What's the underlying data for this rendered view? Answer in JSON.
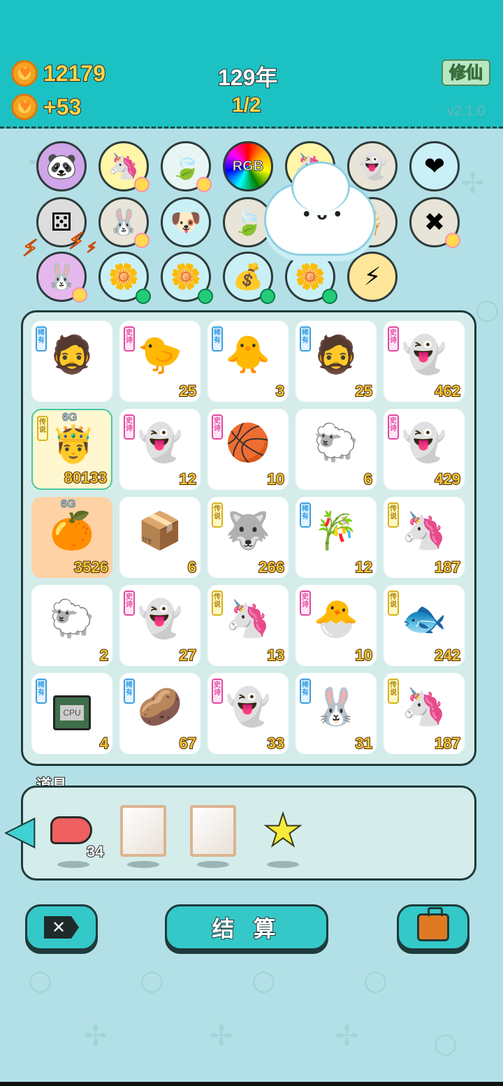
{
  "header": {
    "coins": "12179",
    "coin_gain": "+53",
    "year": "129年",
    "round": "1/2",
    "cultivate_label": "修仙",
    "version": "v2.1.0"
  },
  "relics": {
    "row1": [
      "panda-icon",
      "unicorn-icon",
      "leaf-icon",
      "rgb-orb-icon",
      "unicorn-icon",
      "ghost-wink-icon",
      "heart-potion-icon"
    ],
    "row2": [
      "dice-icon",
      "rabbit-icon",
      "cool-dog-icon",
      "leaf-icon",
      "",
      "ice-cream-icon",
      "delete-tag-icon"
    ],
    "row3": [
      "rabbit-icon",
      "flower-pot-icon",
      "flower-pot-icon",
      "sack-icon",
      "flower-pot-icon",
      "lightning-orb-icon"
    ],
    "rgb_label": "RGB"
  },
  "board": {
    "rows": [
      [
        {
          "name": "hat-man",
          "icon": "hat-man-icon",
          "rarity": "稀有",
          "count": ""
        },
        {
          "name": "chick-face",
          "icon": "chick-face-icon",
          "rarity": "史诗",
          "count": "25"
        },
        {
          "name": "chicken",
          "icon": "chicken-icon",
          "rarity": "稀有",
          "count": "3"
        },
        {
          "name": "hat-man",
          "icon": "hat-man-icon",
          "rarity": "稀有",
          "count": "25"
        },
        {
          "name": "ghost",
          "icon": "ghost-icon",
          "rarity": "史诗",
          "count": "462"
        }
      ],
      [
        {
          "name": "king-man",
          "icon": "king-man-icon",
          "rarity": "传说",
          "count": "80133",
          "tag": "6G"
        },
        {
          "name": "ghost",
          "icon": "ghost-icon",
          "rarity": "史诗",
          "count": "12"
        },
        {
          "name": "basketball-chick",
          "icon": "basketball-chick-icon",
          "rarity": "史诗",
          "count": "10"
        },
        {
          "name": "sheep",
          "icon": "sheep-icon",
          "rarity": "",
          "count": "6"
        },
        {
          "name": "ghost",
          "icon": "ghost-icon",
          "rarity": "史诗",
          "count": "429"
        }
      ],
      [
        {
          "name": "fruit",
          "icon": "fruit-icon",
          "rarity": "",
          "count": "3526",
          "tag": "6G"
        },
        {
          "name": "package",
          "icon": "package-icon",
          "rarity": "",
          "count": "6"
        },
        {
          "name": "husky-king",
          "icon": "husky-icon",
          "rarity": "传说",
          "count": "266"
        },
        {
          "name": "bamboo",
          "icon": "bamboo-icon",
          "rarity": "稀有",
          "count": "12"
        },
        {
          "name": "unicorn",
          "icon": "unicorn-icon",
          "rarity": "传说",
          "count": "187"
        }
      ],
      [
        {
          "name": "sheep",
          "icon": "sheep-icon",
          "rarity": "",
          "count": "2"
        },
        {
          "name": "ghost",
          "icon": "ghost-icon",
          "rarity": "史诗",
          "count": "27"
        },
        {
          "name": "unicorn",
          "icon": "unicorn-icon",
          "rarity": "传说",
          "count": "13"
        },
        {
          "name": "hair-chick",
          "icon": "hair-chick-icon",
          "rarity": "史诗",
          "count": "10"
        },
        {
          "name": "koi",
          "icon": "koi-icon",
          "rarity": "传说",
          "count": "242"
        }
      ],
      [
        {
          "name": "cpu",
          "icon": "cpu-icon",
          "rarity": "稀有",
          "count": "4"
        },
        {
          "name": "bun",
          "icon": "bun-icon",
          "rarity": "稀有",
          "count": "67"
        },
        {
          "name": "ghost",
          "icon": "ghost-icon",
          "rarity": "史诗",
          "count": "33"
        },
        {
          "name": "rabbit-red",
          "icon": "rabbit-icon",
          "rarity": "稀有",
          "count": "31"
        },
        {
          "name": "unicorn-ball",
          "icon": "unicorn-icon",
          "rarity": "传说",
          "count": "187"
        }
      ]
    ],
    "cpu_label": "CPU"
  },
  "props": {
    "label": "道具",
    "liver_count": "34"
  },
  "buttons": {
    "settle_label": "结 算"
  },
  "colors": {
    "header": "#1cc2c3",
    "background": "#b3e0e6",
    "count_gold": "#f4c430"
  }
}
